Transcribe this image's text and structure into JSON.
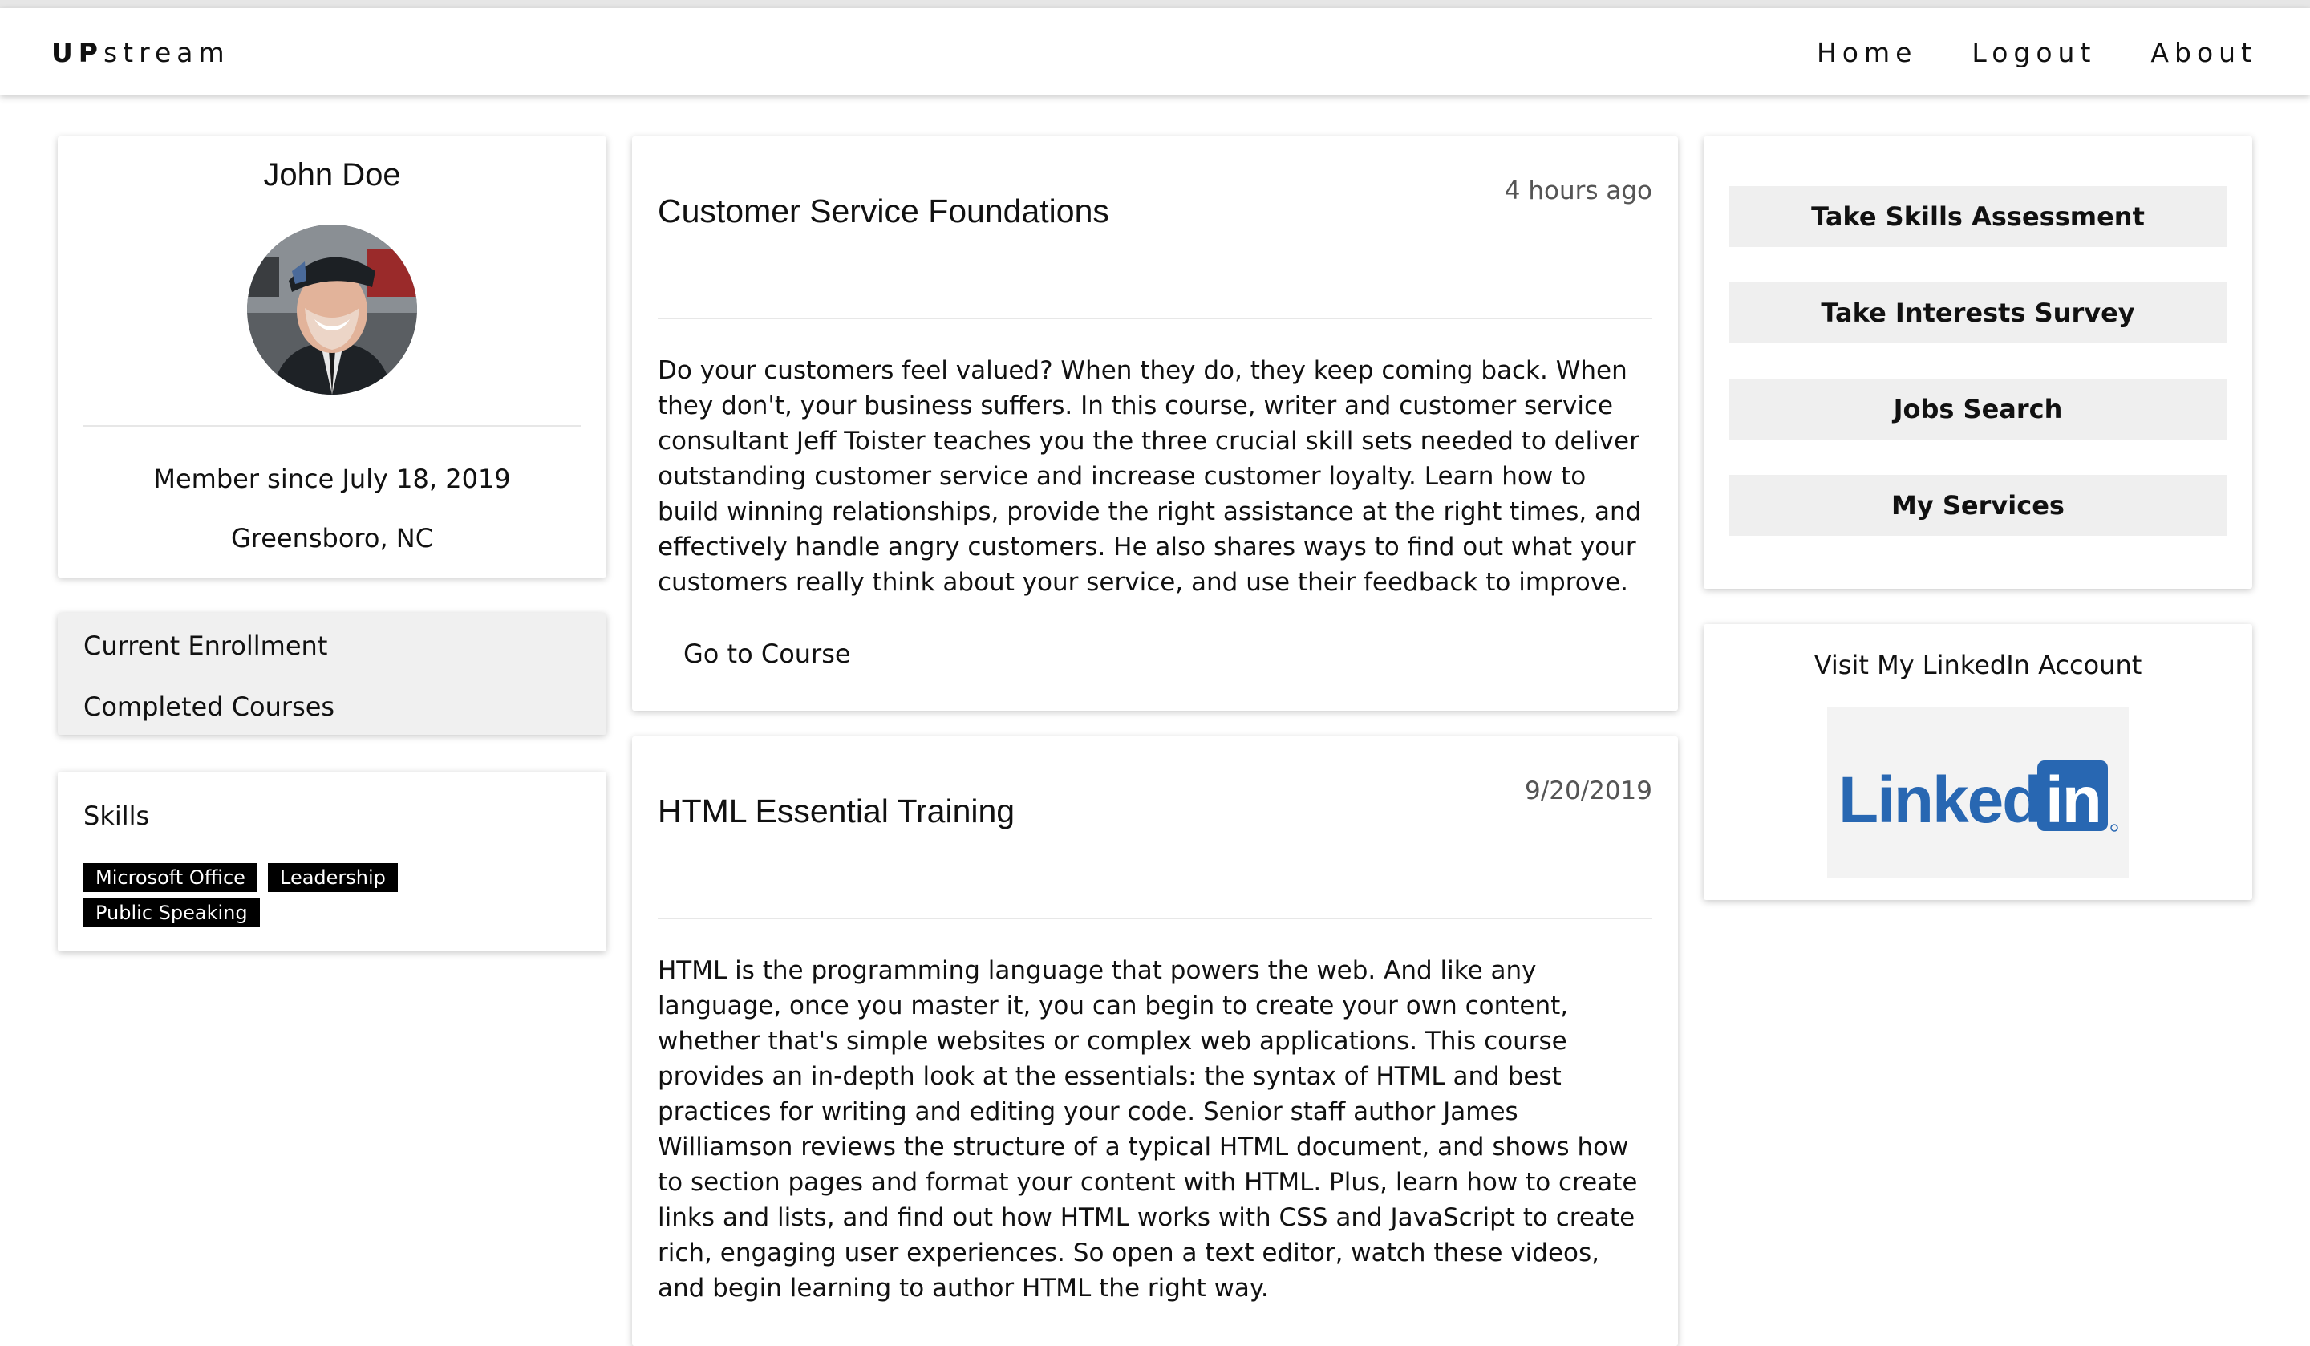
{
  "brand": {
    "bold": "UP",
    "rest": "stream"
  },
  "nav": {
    "home": "Home",
    "logout": "Logout",
    "about": "About"
  },
  "profile": {
    "name": "John Doe",
    "member_since": "Member since July 18, 2019",
    "location": "Greensboro, NC"
  },
  "courses_menu": {
    "current": "Current Enrollment",
    "completed": "Completed Courses"
  },
  "skills": {
    "title": "Skills",
    "tags": [
      "Microsoft Office",
      "Leadership",
      "Public Speaking"
    ]
  },
  "courses": [
    {
      "title": "Customer Service Foundations",
      "time": "4 hours ago",
      "description": "Do your customers feel valued? When they do, they keep coming back. When they don't, your business suffers. In this course, writer and customer service consultant Jeff Toister teaches you the three crucial skill sets needed to deliver outstanding customer service and increase customer loyalty. Learn how to build winning relationships, provide the right assistance at the right times, and effectively handle angry customers. He also shares ways to find out what your customers really think about your service, and use their feedback to improve.",
      "link": "Go to Course"
    },
    {
      "title": "HTML Essential Training",
      "time": "9/20/2019",
      "description": "HTML is the programming language that powers the web. And like any language, once you master it, you can begin to create your own content, whether that's simple websites or complex web applications. This course provides an in-depth look at the essentials: the syntax of HTML and best practices for writing and editing your code. Senior staff author James Williamson reviews the structure of a typical HTML document, and shows how to section pages and format your content with HTML. Plus, learn how to create links and lists, and find out how HTML works with CSS and JavaScript to create rich, engaging user experiences. So open a text editor, watch these videos, and begin learning to author HTML the right way."
    }
  ],
  "actions": {
    "skills_assessment": "Take Skills Assessment",
    "interests_survey": "Take Interests Survey",
    "jobs_search": "Jobs Search",
    "my_services": "My Services"
  },
  "linkedin": {
    "title": "Visit My LinkedIn Account",
    "logo_text": "Linked",
    "logo_in": "in",
    "brand_color": "#2867B2"
  },
  "colors": {
    "tag_bg": "#000000",
    "button_bg": "#efefef",
    "menu_bg": "#f0f0f0"
  }
}
